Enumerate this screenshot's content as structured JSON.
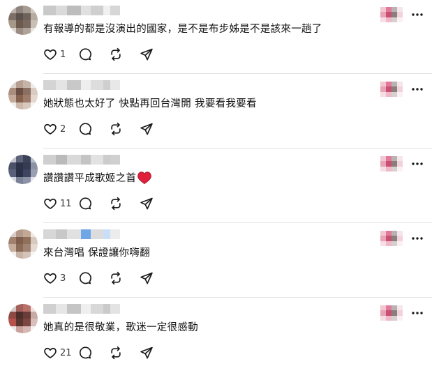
{
  "comments": [
    {
      "text": "有報導的都是沒演出的國家，是不是布步姊是不是該來一趟了",
      "likes": "1",
      "emoji": false,
      "avatar_colors": [
        "#b9b0aa",
        "#8f857e",
        "#a79a90",
        "#cfc7c1",
        "#7c6f67",
        "#5d524b",
        "#6e625a",
        "#b6ab9f",
        "#a69888",
        "#6c5a4f",
        "#7a6a5e",
        "#c8bfb5",
        "#ddd6cf",
        "#9b8d83",
        "#b0a49a",
        "#e8e3de"
      ],
      "name_colors": [
        "#c9c9c9",
        "#dadada",
        "#bdbdbd",
        "#e0e0e0",
        "#cfcfcf",
        "#f0f0f0",
        "#d6d6d6"
      ]
    },
    {
      "text": "她狀態也太好了 快點再回台灣開 我要看我要看",
      "likes": "2",
      "emoji": false,
      "avatar_colors": [
        "#d9d2cd",
        "#b69f92",
        "#c7b4a8",
        "#efeae6",
        "#a98d7d",
        "#6b4f42",
        "#8b6f61",
        "#d9cbc1",
        "#c4aa9a",
        "#86614f",
        "#9e7c6a",
        "#e3d7cf",
        "#f2ede9",
        "#cdb9ac",
        "#d8c8bd",
        "#f7f4f1"
      ],
      "name_colors": [
        "#d4d4d4",
        "#e4e4e4",
        "#c8c8c8",
        "#eeeeee",
        "#dddddd",
        "#cfcfcf",
        "#e8e8e8"
      ]
    },
    {
      "text": "讚讚讚平成歌姬之首",
      "likes": "11",
      "emoji": true,
      "avatar_colors": [
        "#c3c6cf",
        "#5d6479",
        "#3c4257",
        "#b9bdc8",
        "#4b5268",
        "#2c3247",
        "#343b52",
        "#8c92a3",
        "#59607a",
        "#2a3046",
        "#3d4560",
        "#9aa0b1",
        "#d5d8df",
        "#7c8296",
        "#8d93a6",
        "#e4e6eb"
      ],
      "name_colors": [
        "#cfcfcf",
        "#bababa",
        "#d9d9d9",
        "#c4c4c4",
        "#e2e2e2",
        "#cccccc",
        "#d0d0d0"
      ]
    },
    {
      "text": "來台灣唱 保證讓你嗨翻",
      "likes": "3",
      "emoji": false,
      "avatar_colors": [
        "#d8cdc6",
        "#b49a8a",
        "#c3a896",
        "#efe9e5",
        "#a0826f",
        "#7f5f4c",
        "#906f5b",
        "#d8c9bf",
        "#c6ad9c",
        "#8a6b58",
        "#a08372",
        "#e5dad2",
        "#f3eeeb",
        "#c8b4a7",
        "#d3c3b8",
        "#f8f5f3"
      ],
      "name_colors": [
        "#d7d7d7",
        "#c8c8c8",
        "#e1e1e1",
        "#6ea6e8",
        "#dcdcdc",
        "#c9dff7",
        "#ececec"
      ]
    },
    {
      "text": "她真的是很敬業，歌迷一定很感動",
      "likes": "21",
      "emoji": false,
      "avatar_colors": [
        "#d3c9c6",
        "#a2615a",
        "#b87069",
        "#ece2df",
        "#8d4a43",
        "#4d2e2a",
        "#6a3c37",
        "#c8aaa5",
        "#b6504b",
        "#5a3530",
        "#7d4741",
        "#d9bfbb",
        "#efe7e5",
        "#c9a29d",
        "#d6b8b4",
        "#f6f1f0"
      ],
      "name_colors": [
        "#d0d0d0",
        "#e6e6e6",
        "#c5c5c5",
        "#efefef",
        "#d8d8d8",
        "#cacaca",
        "#e3e3e3"
      ]
    }
  ],
  "side_colors": [
    "#f4c6d2",
    "#e07a98",
    "#b8b2b0",
    "#f6e6eb",
    "#e9a3b6",
    "#c94f73",
    "#8a7f7c",
    "#f1d3dc",
    "#f7dde4",
    "#f0b9c8",
    "#d7d0ce",
    "#fbf1f4"
  ]
}
